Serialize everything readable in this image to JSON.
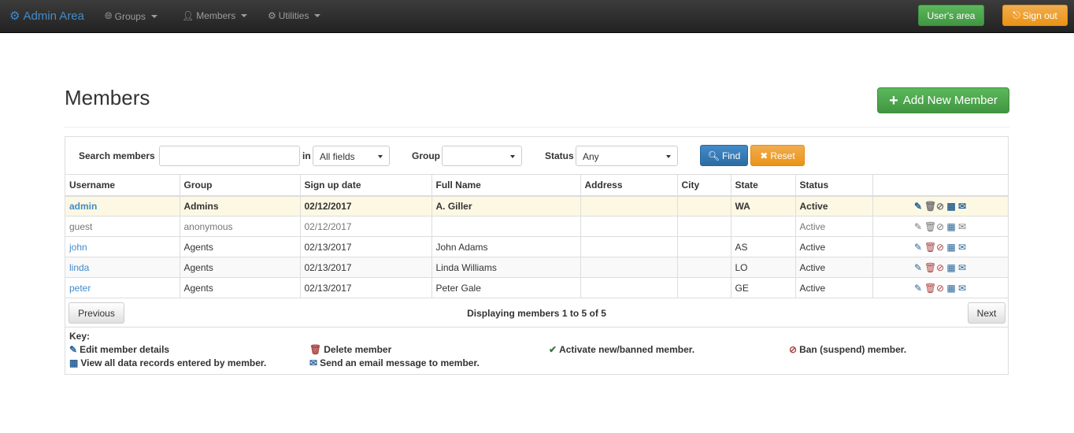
{
  "nav": {
    "brand": "Admin Area",
    "groups": "Groups",
    "members": "Members",
    "utilities": "Utilities",
    "users_area": "User's area",
    "sign_out": "Sign out"
  },
  "header": {
    "title": "Members",
    "add_button": "Add New Member"
  },
  "search": {
    "search_label": "Search members",
    "search_value": "",
    "in_label": "in",
    "field_select": "All fields",
    "group_label": "Group",
    "group_select": "",
    "status_label": "Status",
    "status_select": "Any",
    "find_button": "Find",
    "reset_button": "Reset"
  },
  "table": {
    "columns": [
      "Username",
      "Group",
      "Sign up date",
      "Full Name",
      "Address",
      "City",
      "State",
      "Status"
    ],
    "rows": [
      {
        "username": "admin",
        "group": "Admins",
        "signup": "02/12/2017",
        "fullname": "A. Giller",
        "address": "",
        "city": "",
        "state": "WA",
        "status": "Active"
      },
      {
        "username": "guest",
        "group": "anonymous",
        "signup": "02/12/2017",
        "fullname": "",
        "address": "",
        "city": "",
        "state": "",
        "status": "Active"
      },
      {
        "username": "john",
        "group": "Agents",
        "signup": "02/13/2017",
        "fullname": "John Adams",
        "address": "",
        "city": "",
        "state": "AS",
        "status": "Active"
      },
      {
        "username": "linda",
        "group": "Agents",
        "signup": "02/13/2017",
        "fullname": "Linda Williams",
        "address": "",
        "city": "",
        "state": "LO",
        "status": "Active"
      },
      {
        "username": "peter",
        "group": "Agents",
        "signup": "02/13/2017",
        "fullname": "Peter Gale",
        "address": "",
        "city": "",
        "state": "GE",
        "status": "Active"
      }
    ]
  },
  "pager": {
    "previous": "Previous",
    "next": "Next",
    "display_prefix": "Displaying members ",
    "from": "1",
    "to_word": " to ",
    "to": "5",
    "of_word": " of ",
    "total": "5"
  },
  "key": {
    "title": "Key:",
    "edit": "Edit member details",
    "delete": "Delete member",
    "activate": "Activate new/banned member.",
    "ban": "Ban (suspend) member.",
    "records": "View all data records entered by member.",
    "email": "Send an email message to member."
  },
  "icons": {
    "brand": "gear-icon",
    "groups": "globe-icon",
    "members": "user-icon",
    "utilities": "cog-icon",
    "sign_out": "log-out-icon",
    "add": "plus-icon",
    "find": "search-icon",
    "reset": "remove-icon",
    "edit": "pencil-icon",
    "delete": "trash-icon",
    "ban": "ban-icon",
    "records": "th-grid-icon",
    "email": "envelope-icon",
    "activate": "check-icon"
  },
  "colors": {
    "primary": "#428bca",
    "success": "#5cb85c",
    "warning": "#f0ad4e",
    "highlight_row": "#fcf8e3"
  }
}
